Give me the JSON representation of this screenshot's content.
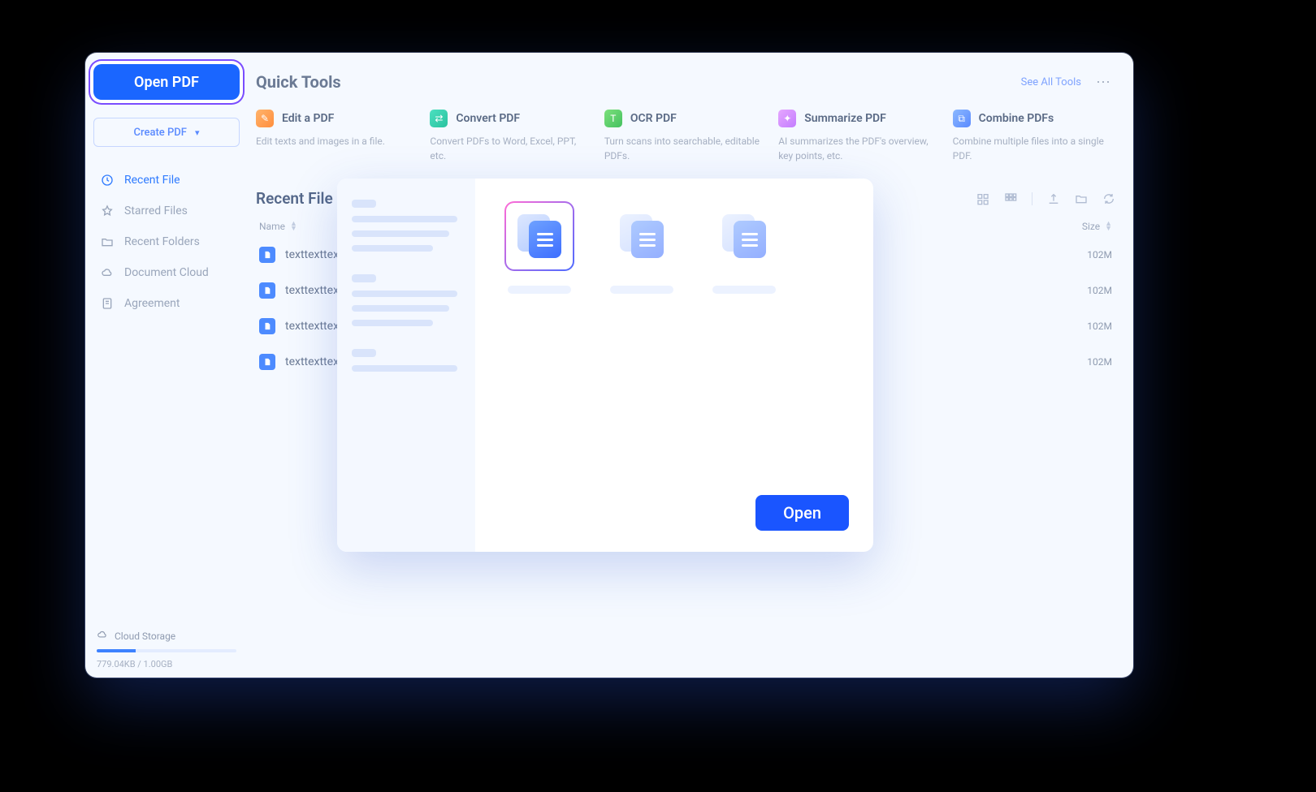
{
  "sidebar": {
    "open_pdf_label": "Open PDF",
    "create_pdf_label": "Create PDF",
    "nav": [
      {
        "label": "Recent File",
        "icon": "clock"
      },
      {
        "label": "Starred Files",
        "icon": "star"
      },
      {
        "label": "Recent Folders",
        "icon": "folder"
      },
      {
        "label": "Document Cloud",
        "icon": "cloud"
      },
      {
        "label": "Agreement",
        "icon": "agreement"
      }
    ],
    "cloud_storage": {
      "label": "Cloud Storage",
      "text": "779.04KB / 1.00GB",
      "percent": 28
    }
  },
  "quick_tools": {
    "title": "Quick Tools",
    "see_all": "See All Tools",
    "tools": [
      {
        "title": "Edit a PDF",
        "desc": "Edit texts and images in a file."
      },
      {
        "title": "Convert PDF",
        "desc": "Convert PDFs to Word, Excel, PPT, etc."
      },
      {
        "title": "OCR PDF",
        "desc": "Turn scans into searchable, editable PDFs."
      },
      {
        "title": "Summarize PDF",
        "desc": "AI summarizes the PDF's overview, key points, etc."
      },
      {
        "title": "Combine PDFs",
        "desc": "Combine multiple files into a single PDF."
      }
    ]
  },
  "recent_files": {
    "title": "Recent File",
    "columns": {
      "name": "Name",
      "size": "Size"
    },
    "rows": [
      {
        "name": "texttexttexttex",
        "size": "102M"
      },
      {
        "name": "texttexttexttex",
        "size": "102M"
      },
      {
        "name": "texttexttexttex",
        "size": "102M"
      },
      {
        "name": "texttexttexttex",
        "size": "102M"
      }
    ]
  },
  "dialog": {
    "open_label": "Open"
  }
}
